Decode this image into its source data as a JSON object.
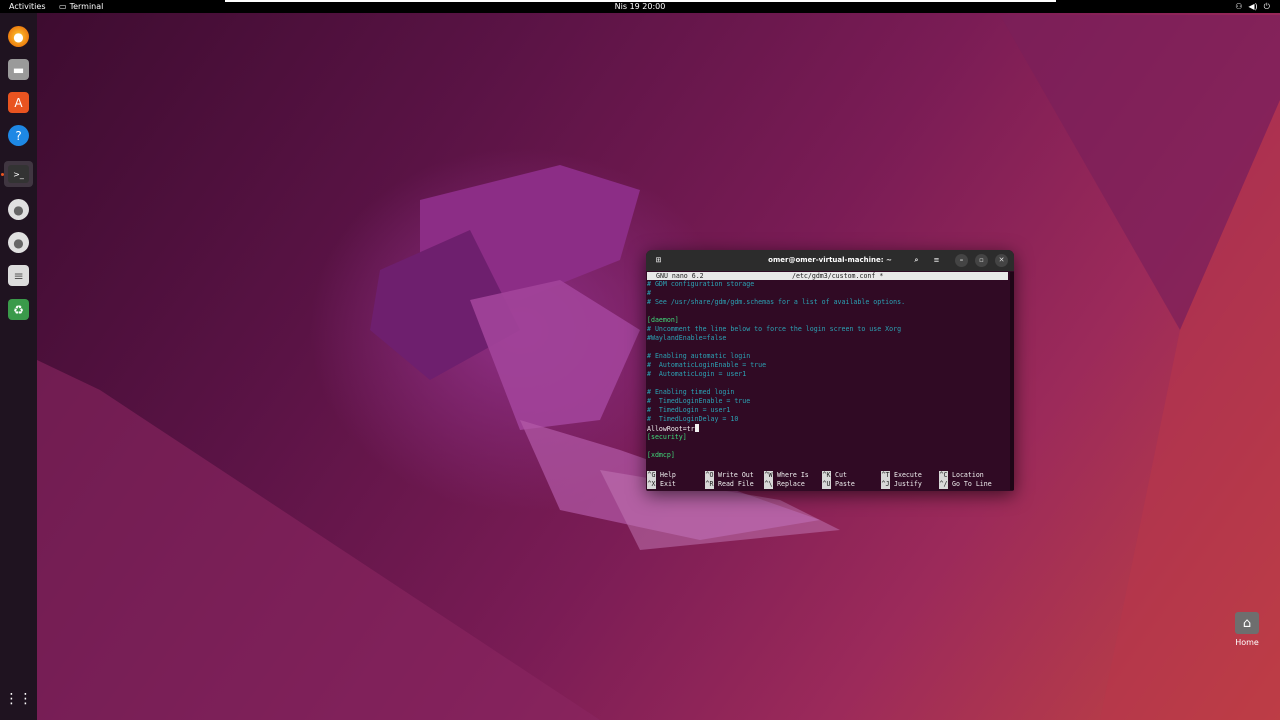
{
  "topbar": {
    "activities": "Activities",
    "app_name": "Terminal",
    "clock": "Nis 19  20:00"
  },
  "dock": {
    "items": [
      "firefox-icon",
      "files-icon",
      "software-icon",
      "help-icon",
      "terminal-icon",
      "disc-icon",
      "disc-icon",
      "drive-icon",
      "trash-icon"
    ],
    "apps_grid": "show-apps-icon"
  },
  "terminal": {
    "title": "omer@omer-virtual-machine: ~",
    "nano_version": "GNU nano 6.2",
    "file_name": "/etc/gdm3/custom.conf *",
    "lines": [
      "# GDM configuration storage",
      "#",
      "# See /usr/share/gdm/gdm.schemas for a list of available options.",
      "",
      "[daemon]",
      "# Uncomment the line below to force the login screen to use Xorg",
      "#WaylandEnable=false",
      "",
      "# Enabling automatic login",
      "#  AutomaticLoginEnable = true",
      "#  AutomaticLogin = user1",
      "",
      "# Enabling timed login",
      "#  TimedLoginEnable = true",
      "#  TimedLogin = user1",
      "#  TimedLoginDelay = 10",
      "AllowRoot=tr",
      "[security]",
      "",
      "[xdmcp]"
    ],
    "shortcuts_row1": [
      {
        "key": "^G",
        "label": "Help"
      },
      {
        "key": "^O",
        "label": "Write Out"
      },
      {
        "key": "^W",
        "label": "Where Is"
      },
      {
        "key": "^K",
        "label": "Cut"
      },
      {
        "key": "^T",
        "label": "Execute"
      },
      {
        "key": "^C",
        "label": "Location"
      }
    ],
    "shortcuts_row2": [
      {
        "key": "^X",
        "label": "Exit"
      },
      {
        "key": "^R",
        "label": "Read File"
      },
      {
        "key": "^\\",
        "label": "Replace"
      },
      {
        "key": "^U",
        "label": "Paste"
      },
      {
        "key": "^J",
        "label": "Justify"
      },
      {
        "key": "^/",
        "label": "Go To Line"
      }
    ]
  },
  "desktop": {
    "home_label": "Home"
  },
  "colors": {
    "terminal_bg": "#300a24",
    "accent": "#e95420"
  }
}
